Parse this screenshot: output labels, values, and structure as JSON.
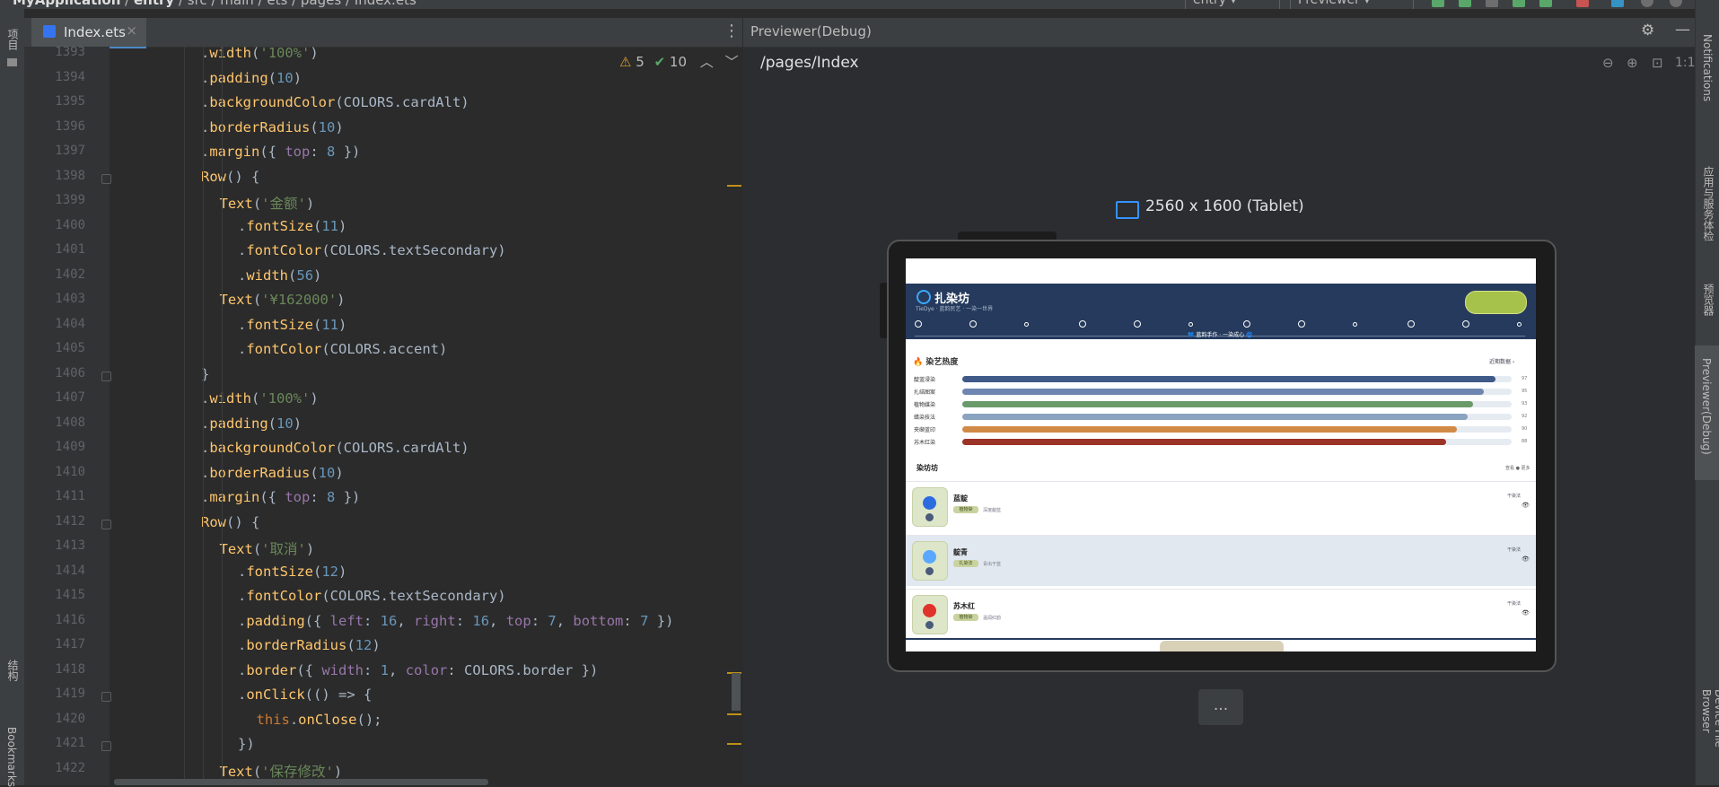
{
  "topbar": {
    "breadcrumbs": [
      "MyApplication",
      "entry",
      "src",
      "main",
      "ets",
      "pages",
      "Index.ets"
    ],
    "run_config": "entry",
    "previewer_label": "Previewer"
  },
  "left_strip": {
    "project": "项目",
    "structure": "结构",
    "bookmarks": "Bookmarks"
  },
  "editor": {
    "tab_label": "Index.ets",
    "warnings": "5",
    "weak_warnings": "10",
    "lines": [
      {
        "n": "1393",
        "text": ".width('100%')"
      },
      {
        "n": "1394",
        "text": ".padding(10)"
      },
      {
        "n": "1395",
        "text": ".backgroundColor(COLORS.cardAlt)"
      },
      {
        "n": "1396",
        "text": ".borderRadius(10)"
      },
      {
        "n": "1397",
        "text": ".margin({ top: 8 })"
      },
      {
        "n": "1398",
        "text": "Row() {"
      },
      {
        "n": "1399",
        "text": "Text('金额')"
      },
      {
        "n": "1400",
        "text": ".fontSize(11)"
      },
      {
        "n": "1401",
        "text": ".fontColor(COLORS.textSecondary)"
      },
      {
        "n": "1402",
        "text": ".width(56)"
      },
      {
        "n": "1403",
        "text": "Text('¥162000')"
      },
      {
        "n": "1404",
        "text": ".fontSize(11)"
      },
      {
        "n": "1405",
        "text": ".fontColor(COLORS.accent)"
      },
      {
        "n": "1406",
        "text": "}"
      },
      {
        "n": "1407",
        "text": ".width('100%')"
      },
      {
        "n": "1408",
        "text": ".padding(10)"
      },
      {
        "n": "1409",
        "text": ".backgroundColor(COLORS.cardAlt)"
      },
      {
        "n": "1410",
        "text": ".borderRadius(10)"
      },
      {
        "n": "1411",
        "text": ".margin({ top: 8 })"
      },
      {
        "n": "1412",
        "text": "Row() {"
      },
      {
        "n": "1413",
        "text": "Text('取消')"
      },
      {
        "n": "1414",
        "text": ".fontSize(12)"
      },
      {
        "n": "1415",
        "text": ".fontColor(COLORS.textSecondary)"
      },
      {
        "n": "1416",
        "text": ".padding({ left: 16, right: 16, top: 7, bottom: 7 })"
      },
      {
        "n": "1417",
        "text": ".borderRadius(12)"
      },
      {
        "n": "1418",
        "text": ".border({ width: 1, color: COLORS.border })"
      },
      {
        "n": "1419",
        "text": ".onClick(() => {"
      },
      {
        "n": "1420",
        "text": "this.onClose();"
      },
      {
        "n": "1421",
        "text": "})"
      },
      {
        "n": "1422",
        "text": "Text('保存修改')"
      }
    ]
  },
  "previewer": {
    "title": "Previewer(Debug)",
    "path": "/pages/Index",
    "device": "2560 x 1600 (Tablet)",
    "zoom_label": "1:1",
    "more_label": "..."
  },
  "app": {
    "title": "扎染坊",
    "subtitle": "TieDye · 蓝韵民艺 · 一染一世界",
    "head_note": "💙 蓝韵手作 · 一染成心 🌀",
    "section1_title": "🔥 染艺热度",
    "section1_right": "近期数据 ›",
    "bars": [
      {
        "label": "靛蓝浸染",
        "value": 97,
        "color": "#3f5a88"
      },
      {
        "label": "扎结图案",
        "value": 95,
        "color": "#6f86b0"
      },
      {
        "label": "植物媒染",
        "value": 93,
        "color": "#6a9a6a"
      },
      {
        "label": "蜡染技法",
        "value": 92,
        "color": "#8aa3c0"
      },
      {
        "label": "夹缬蓝印",
        "value": 90,
        "color": "#d18a46"
      },
      {
        "label": "苏木红染",
        "value": 88,
        "color": "#9b3327"
      }
    ],
    "section2_title": "染坊坊",
    "section2_right": "查看 ● 更多",
    "cards": [
      {
        "name": "蓝靛",
        "tag": "植物染",
        "sub": "深邃靛蓝",
        "right": "干染法",
        "color": "#2d6ce0"
      },
      {
        "name": "靛青",
        "tag": "扎染法",
        "sub": "青出于蓝",
        "right": "干染法",
        "color": "#59a7ff"
      },
      {
        "name": "苏木红",
        "tag": "植物染",
        "sub": "温润红韵",
        "right": "干染法",
        "color": "#e0332b"
      }
    ]
  },
  "right_strip": {
    "notifications": "Notifications",
    "app_services": "应用与服务体检",
    "preview": "预览器",
    "previewer_debug": "Previewer(Debug)",
    "device_file_browser": "Device File Browser"
  }
}
